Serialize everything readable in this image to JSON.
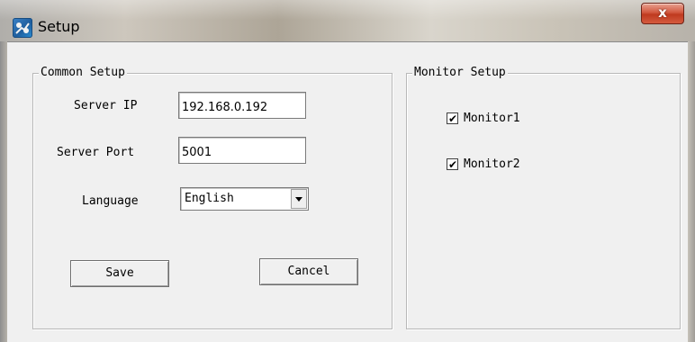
{
  "window": {
    "title": "Setup",
    "icon": "app-icon",
    "close_label": "x"
  },
  "common_setup": {
    "title": "Common Setup",
    "server_ip": {
      "label": "Server IP",
      "value": "192.168.0.192"
    },
    "server_port": {
      "label": "Server Port",
      "value": "5001"
    },
    "language": {
      "label": "Language",
      "value": "English"
    },
    "save_label": "Save",
    "cancel_label": "Cancel"
  },
  "monitor_setup": {
    "title": "Monitor Setup",
    "monitors": [
      {
        "label": "Monitor1",
        "checked": true,
        "mark": "✔"
      },
      {
        "label": "Monitor2",
        "checked": true,
        "mark": "✔"
      }
    ]
  }
}
